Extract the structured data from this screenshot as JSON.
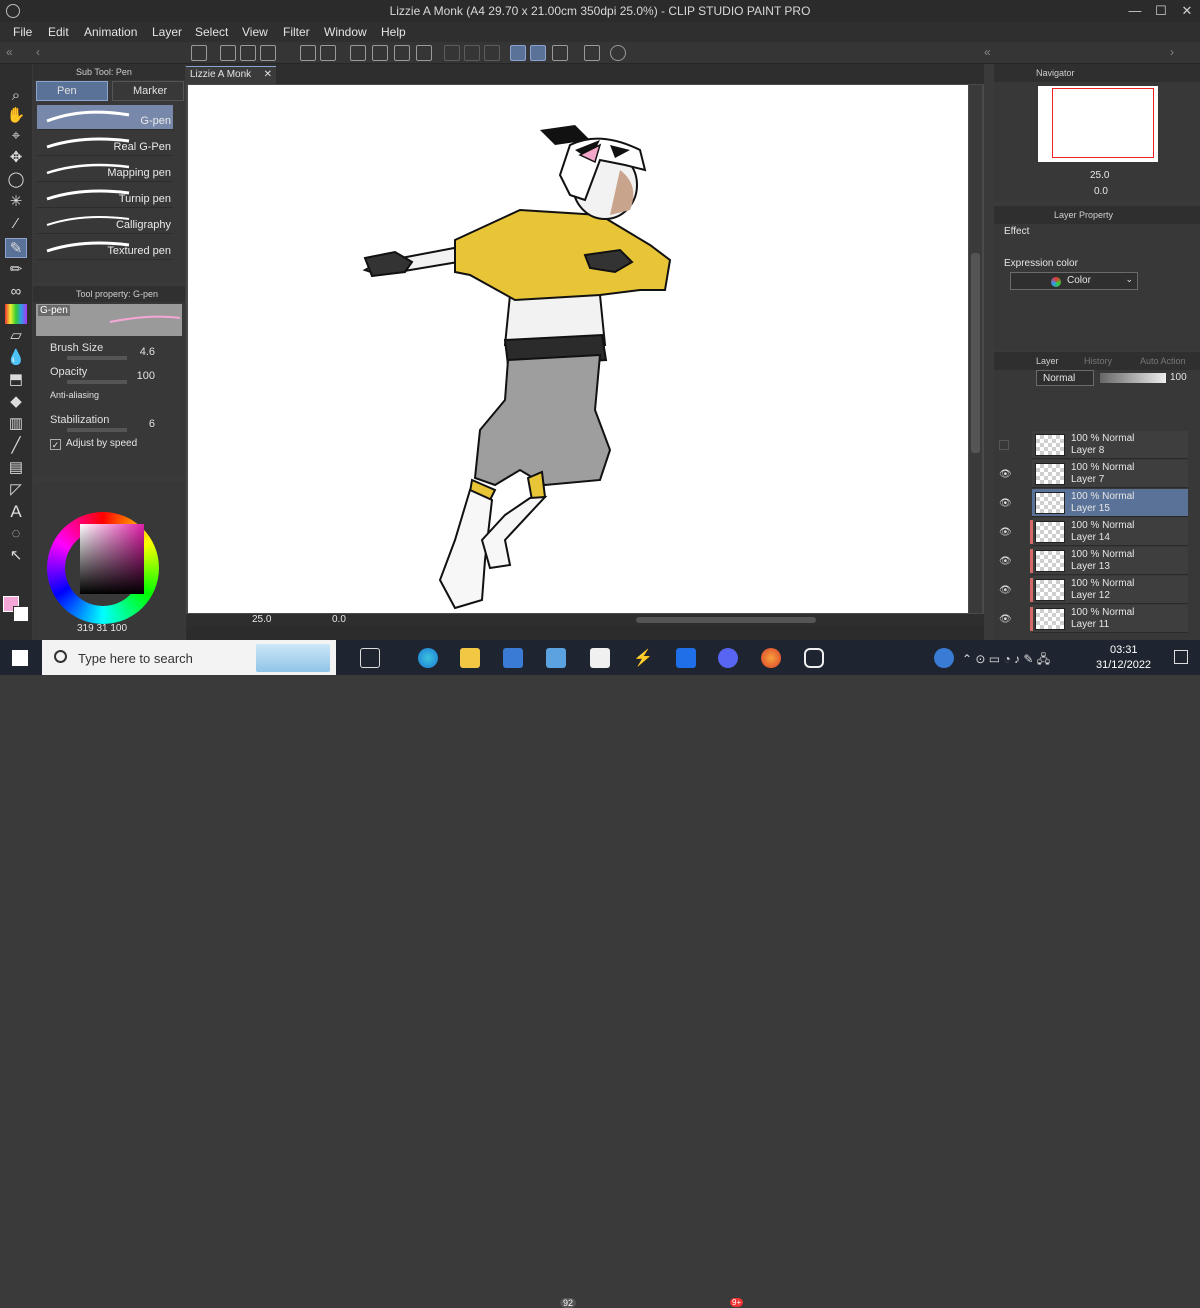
{
  "window": {
    "title": "Lizzie A Monk (A4 29.70 x 21.00cm 350dpi 25.0%) - CLIP STUDIO PAINT PRO",
    "min": "—",
    "max": "☐",
    "close": "✕"
  },
  "menu": [
    "File",
    "Edit",
    "Animation",
    "Layer",
    "Select",
    "View",
    "Filter",
    "Window",
    "Help"
  ],
  "subtool": {
    "header": "Sub Tool: Pen",
    "tabs": [
      "Pen",
      "Marker"
    ],
    "brushes": [
      "G-pen",
      "Real G-Pen",
      "Mapping pen",
      "Turnip pen",
      "Calligraphy",
      "Textured pen"
    ]
  },
  "tool_property": {
    "header": "Tool property: G-pen",
    "preview_label": "G-pen",
    "brush_size_label": "Brush Size",
    "brush_size": "4.6",
    "opacity_label": "Opacity",
    "opacity": "100",
    "antialias_label": "Anti-aliasing",
    "stabilization_label": "Stabilization",
    "stabilization": "6",
    "adjust_speed": "Adjust by speed"
  },
  "color": {
    "main": "#f4a6d7",
    "sub": "#ffffff",
    "readout": "319",
    "readout2": "31",
    "readout3": "100"
  },
  "document_tab": "Lizzie A Monk",
  "canvas_status": {
    "zoom": "25.0",
    "angle": "0.0"
  },
  "navigator": {
    "header": "Navigator",
    "zoom": "25.0",
    "angle": "0.0"
  },
  "layer_property": {
    "header": "Layer Property",
    "effect_label": "Effect",
    "expression_label": "Expression color",
    "expression_value": "Color"
  },
  "layer_panel": {
    "tabs": [
      "Layer",
      "History",
      "Auto Action"
    ],
    "blend_mode": "Normal",
    "opacity": "100",
    "layers": [
      {
        "mode": "100 % Normal",
        "name": "Layer 8",
        "visible": false,
        "selected": false,
        "red": false
      },
      {
        "mode": "100 % Normal",
        "name": "Layer 7",
        "visible": true,
        "selected": false,
        "red": false
      },
      {
        "mode": "100 % Normal",
        "name": "Layer 15",
        "visible": true,
        "selected": true,
        "red": false
      },
      {
        "mode": "100 % Normal",
        "name": "Layer 14",
        "visible": true,
        "selected": false,
        "red": true
      },
      {
        "mode": "100 % Normal",
        "name": "Layer 13",
        "visible": true,
        "selected": false,
        "red": true
      },
      {
        "mode": "100 % Normal",
        "name": "Layer 12",
        "visible": true,
        "selected": false,
        "red": true
      },
      {
        "mode": "100 % Normal",
        "name": "Layer 11",
        "visible": true,
        "selected": false,
        "red": true
      }
    ]
  },
  "taskbar": {
    "search_placeholder": "Type here to search",
    "mail_badge": "92",
    "discord_badge": "9+",
    "time": "03:31",
    "date": "31/12/2022"
  },
  "colors": {
    "accent": "#5a7198",
    "shirt": "#e8c437",
    "pants": "#9e9e9e"
  }
}
